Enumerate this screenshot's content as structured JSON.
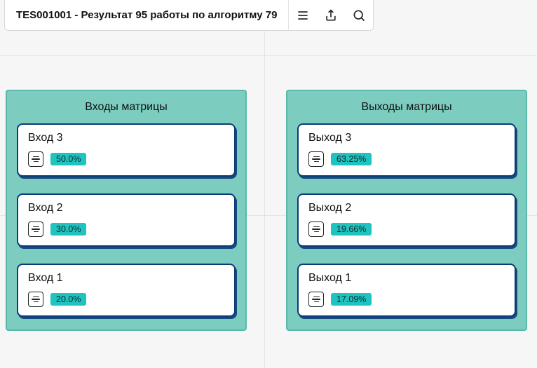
{
  "header": {
    "title": "TES001001 - Результат 95 работы по алгоритму 79"
  },
  "panels": {
    "left": {
      "title": "Входы матрицы",
      "cards": [
        {
          "title": "Вход 3",
          "badge": "50.0%"
        },
        {
          "title": "Вход 2",
          "badge": "30.0%"
        },
        {
          "title": "Вход 1",
          "badge": "20.0%"
        }
      ]
    },
    "right": {
      "title": "Выходы матрицы",
      "cards": [
        {
          "title": "Выход 3",
          "badge": "63.25%"
        },
        {
          "title": "Выход 2",
          "badge": "19.66%"
        },
        {
          "title": "Выход 1",
          "badge": "17.09%"
        }
      ]
    }
  },
  "colors": {
    "panel_bg": "#7ccdc0",
    "panel_border": "#59b8aa",
    "card_border": "#0b3c78",
    "badge_bg": "#1fc3c0"
  }
}
